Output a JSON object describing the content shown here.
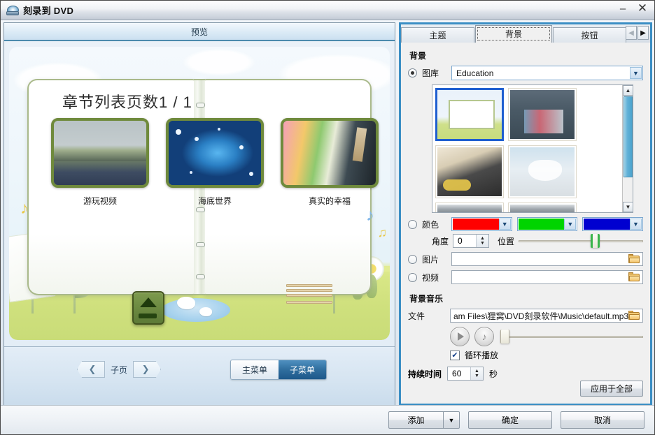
{
  "window": {
    "title": "刻录到 DVD",
    "icon": "dvd-disc-icon",
    "minimize_label": "–",
    "close_label": "✕"
  },
  "preview": {
    "header_label": "预览",
    "menu_title": "章节列表页数1 / 1",
    "chapters": [
      {
        "label": "游玩视频"
      },
      {
        "label": "海底世界"
      },
      {
        "label": "真实的幸福"
      }
    ],
    "footer": {
      "prev_label": "❮",
      "next_label": "❯",
      "pager_label": "子页",
      "main_menu_label": "主菜单",
      "sub_menu_label": "子菜单",
      "selected_menu": "子菜单"
    }
  },
  "panel": {
    "tabs": [
      {
        "label": "主题",
        "selected": false
      },
      {
        "label": "背景",
        "selected": true
      },
      {
        "label": "按钮",
        "selected": false
      }
    ],
    "tab_nav": {
      "prev": "◀",
      "next": "▶"
    },
    "background": {
      "group_title": "背景",
      "gallery": {
        "label": "图库",
        "value": "Education",
        "selected": true,
        "caret": "▼"
      },
      "thumbnails": [
        {
          "name": "open-book-scene",
          "selected": true
        },
        {
          "name": "classroom-hands",
          "selected": false
        },
        {
          "name": "graduation-cap",
          "selected": false
        },
        {
          "name": "students-desk",
          "selected": false
        },
        {
          "name": "blackboard-a",
          "selected": false
        },
        {
          "name": "blackboard-b",
          "selected": false
        }
      ],
      "scroll": {
        "up": "▲",
        "down": "▼"
      },
      "color": {
        "label": "颜色",
        "selected": false,
        "swatches": [
          "#ff0000",
          "#00d400",
          "#0000d0"
        ],
        "caret": "▼"
      },
      "angle": {
        "label": "角度",
        "value": "0",
        "up": "▲",
        "down": "▼"
      },
      "position": {
        "label": "位置",
        "percent": 60
      },
      "image": {
        "label": "图片",
        "value": "",
        "selected": false,
        "browse_icon": "folder-icon"
      },
      "video": {
        "label": "视频",
        "value": "",
        "selected": false,
        "browse_icon": "folder-icon"
      }
    },
    "music": {
      "group_title": "背景音乐",
      "file_label": "文件",
      "file_value": "am Files\\狸窝\\DVD刻录软件\\Music\\default.mp3",
      "browse_icon": "folder-icon",
      "play_icon": "play-icon",
      "mute_icon": "music-note-icon",
      "volume_percent": 2,
      "loop": {
        "label": "循环播放",
        "checked": true,
        "mark": "✔"
      },
      "duration": {
        "label": "持续时间",
        "value": "60",
        "unit": "秒",
        "up": "▲",
        "down": "▼"
      },
      "apply_all_label": "应用于全部"
    }
  },
  "footer": {
    "add_label": "添加",
    "add_caret": "▼",
    "ok_label": "确定",
    "cancel_label": "取消"
  }
}
